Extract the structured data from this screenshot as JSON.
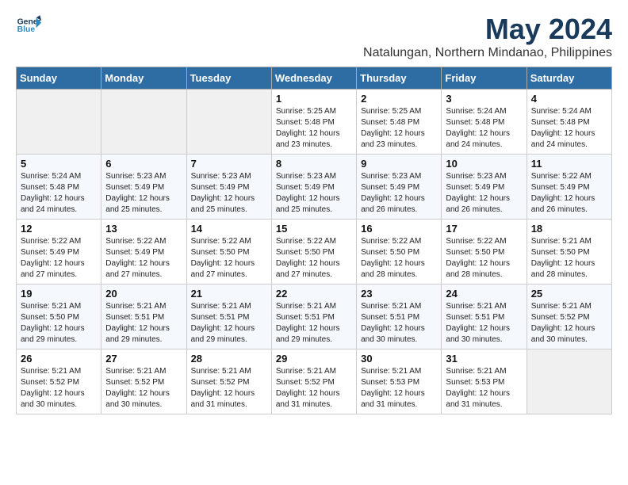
{
  "logo": {
    "line1": "General",
    "line2": "Blue"
  },
  "title": "May 2024",
  "subtitle": "Natalungan, Northern Mindanao, Philippines",
  "weekdays": [
    "Sunday",
    "Monday",
    "Tuesday",
    "Wednesday",
    "Thursday",
    "Friday",
    "Saturday"
  ],
  "weeks": [
    [
      {
        "day": "",
        "info": ""
      },
      {
        "day": "",
        "info": ""
      },
      {
        "day": "",
        "info": ""
      },
      {
        "day": "1",
        "info": "Sunrise: 5:25 AM\nSunset: 5:48 PM\nDaylight: 12 hours\nand 23 minutes."
      },
      {
        "day": "2",
        "info": "Sunrise: 5:25 AM\nSunset: 5:48 PM\nDaylight: 12 hours\nand 23 minutes."
      },
      {
        "day": "3",
        "info": "Sunrise: 5:24 AM\nSunset: 5:48 PM\nDaylight: 12 hours\nand 24 minutes."
      },
      {
        "day": "4",
        "info": "Sunrise: 5:24 AM\nSunset: 5:48 PM\nDaylight: 12 hours\nand 24 minutes."
      }
    ],
    [
      {
        "day": "5",
        "info": "Sunrise: 5:24 AM\nSunset: 5:48 PM\nDaylight: 12 hours\nand 24 minutes."
      },
      {
        "day": "6",
        "info": "Sunrise: 5:23 AM\nSunset: 5:49 PM\nDaylight: 12 hours\nand 25 minutes."
      },
      {
        "day": "7",
        "info": "Sunrise: 5:23 AM\nSunset: 5:49 PM\nDaylight: 12 hours\nand 25 minutes."
      },
      {
        "day": "8",
        "info": "Sunrise: 5:23 AM\nSunset: 5:49 PM\nDaylight: 12 hours\nand 25 minutes."
      },
      {
        "day": "9",
        "info": "Sunrise: 5:23 AM\nSunset: 5:49 PM\nDaylight: 12 hours\nand 26 minutes."
      },
      {
        "day": "10",
        "info": "Sunrise: 5:23 AM\nSunset: 5:49 PM\nDaylight: 12 hours\nand 26 minutes."
      },
      {
        "day": "11",
        "info": "Sunrise: 5:22 AM\nSunset: 5:49 PM\nDaylight: 12 hours\nand 26 minutes."
      }
    ],
    [
      {
        "day": "12",
        "info": "Sunrise: 5:22 AM\nSunset: 5:49 PM\nDaylight: 12 hours\nand 27 minutes."
      },
      {
        "day": "13",
        "info": "Sunrise: 5:22 AM\nSunset: 5:49 PM\nDaylight: 12 hours\nand 27 minutes."
      },
      {
        "day": "14",
        "info": "Sunrise: 5:22 AM\nSunset: 5:50 PM\nDaylight: 12 hours\nand 27 minutes."
      },
      {
        "day": "15",
        "info": "Sunrise: 5:22 AM\nSunset: 5:50 PM\nDaylight: 12 hours\nand 27 minutes."
      },
      {
        "day": "16",
        "info": "Sunrise: 5:22 AM\nSunset: 5:50 PM\nDaylight: 12 hours\nand 28 minutes."
      },
      {
        "day": "17",
        "info": "Sunrise: 5:22 AM\nSunset: 5:50 PM\nDaylight: 12 hours\nand 28 minutes."
      },
      {
        "day": "18",
        "info": "Sunrise: 5:21 AM\nSunset: 5:50 PM\nDaylight: 12 hours\nand 28 minutes."
      }
    ],
    [
      {
        "day": "19",
        "info": "Sunrise: 5:21 AM\nSunset: 5:50 PM\nDaylight: 12 hours\nand 29 minutes."
      },
      {
        "day": "20",
        "info": "Sunrise: 5:21 AM\nSunset: 5:51 PM\nDaylight: 12 hours\nand 29 minutes."
      },
      {
        "day": "21",
        "info": "Sunrise: 5:21 AM\nSunset: 5:51 PM\nDaylight: 12 hours\nand 29 minutes."
      },
      {
        "day": "22",
        "info": "Sunrise: 5:21 AM\nSunset: 5:51 PM\nDaylight: 12 hours\nand 29 minutes."
      },
      {
        "day": "23",
        "info": "Sunrise: 5:21 AM\nSunset: 5:51 PM\nDaylight: 12 hours\nand 30 minutes."
      },
      {
        "day": "24",
        "info": "Sunrise: 5:21 AM\nSunset: 5:51 PM\nDaylight: 12 hours\nand 30 minutes."
      },
      {
        "day": "25",
        "info": "Sunrise: 5:21 AM\nSunset: 5:52 PM\nDaylight: 12 hours\nand 30 minutes."
      }
    ],
    [
      {
        "day": "26",
        "info": "Sunrise: 5:21 AM\nSunset: 5:52 PM\nDaylight: 12 hours\nand 30 minutes."
      },
      {
        "day": "27",
        "info": "Sunrise: 5:21 AM\nSunset: 5:52 PM\nDaylight: 12 hours\nand 30 minutes."
      },
      {
        "day": "28",
        "info": "Sunrise: 5:21 AM\nSunset: 5:52 PM\nDaylight: 12 hours\nand 31 minutes."
      },
      {
        "day": "29",
        "info": "Sunrise: 5:21 AM\nSunset: 5:52 PM\nDaylight: 12 hours\nand 31 minutes."
      },
      {
        "day": "30",
        "info": "Sunrise: 5:21 AM\nSunset: 5:53 PM\nDaylight: 12 hours\nand 31 minutes."
      },
      {
        "day": "31",
        "info": "Sunrise: 5:21 AM\nSunset: 5:53 PM\nDaylight: 12 hours\nand 31 minutes."
      },
      {
        "day": "",
        "info": ""
      }
    ]
  ]
}
